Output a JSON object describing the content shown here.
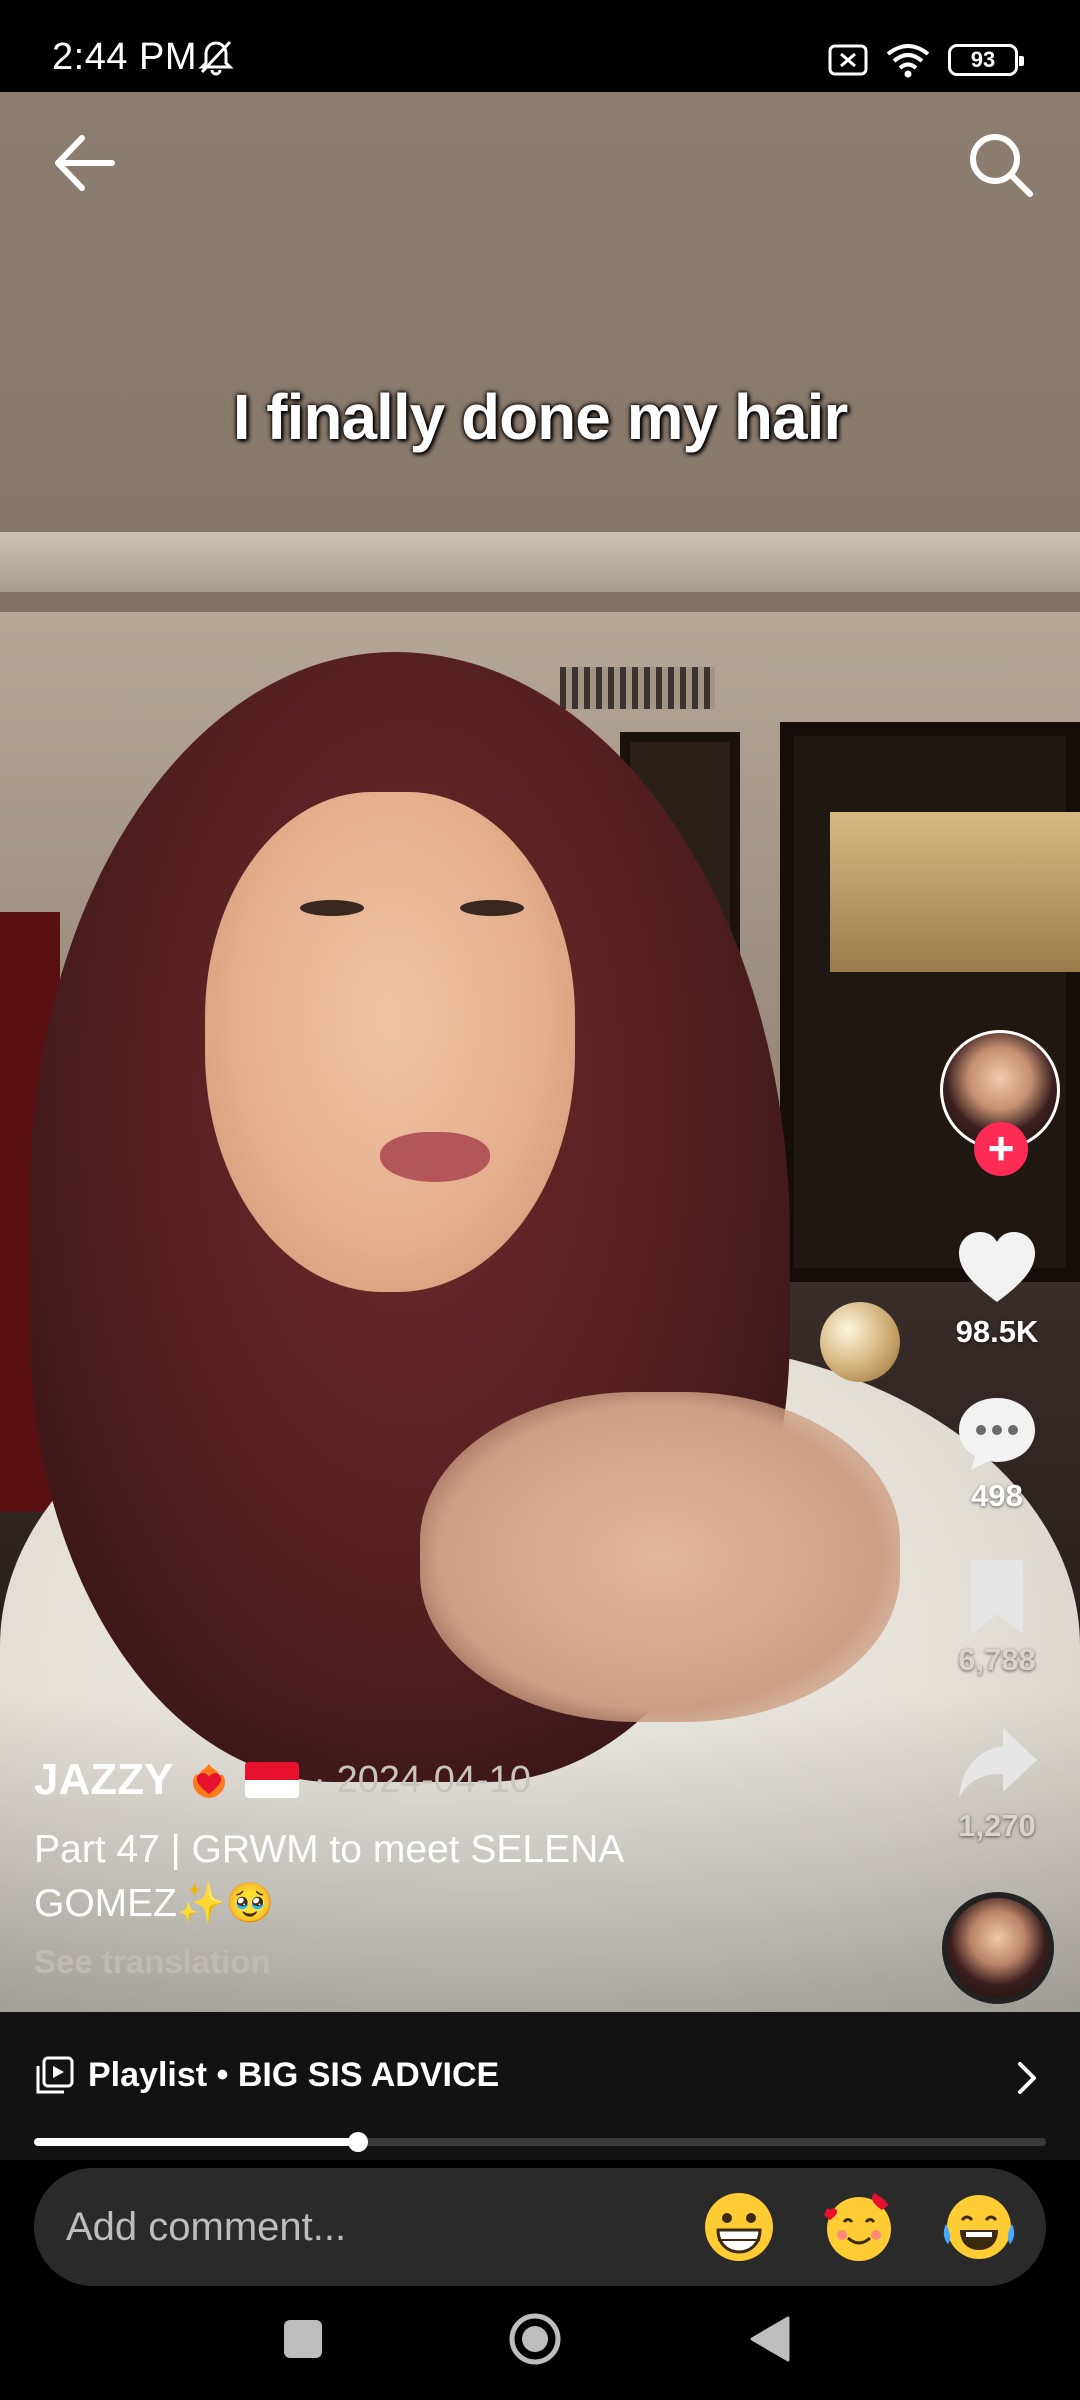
{
  "status_bar": {
    "time": "2:44 PM",
    "battery": "93",
    "icons": [
      "mute-bell-icon",
      "no-sim-icon",
      "wifi-icon",
      "battery-icon"
    ]
  },
  "video": {
    "overlay_text": "I finally done my hair"
  },
  "top_bar": {
    "back_icon": "arrow-left-icon",
    "search_icon": "search-icon"
  },
  "actions": {
    "likes": "98.5K",
    "comments": "498",
    "saves": "6,788",
    "shares": "1,270",
    "follow_symbol": "+"
  },
  "caption": {
    "author": "JAZZY",
    "date": "· 2024-04-10",
    "description_line1": "Part 47 | GRWM to meet SELENA",
    "description_line2": "GOMEZ✨🥹",
    "see_translation": "See translation"
  },
  "playlist": {
    "label": "Playlist • BIG SIS ADVICE",
    "progress": 0.32
  },
  "comment_bar": {
    "placeholder": "Add comment...",
    "emojis": [
      "grinning-face",
      "smiling-face-with-hearts",
      "face-with-tears-of-joy"
    ]
  },
  "colors": {
    "accent": "#fe2c55",
    "background": "#000000",
    "bar": "#121212",
    "input": "#2a2a2a"
  }
}
